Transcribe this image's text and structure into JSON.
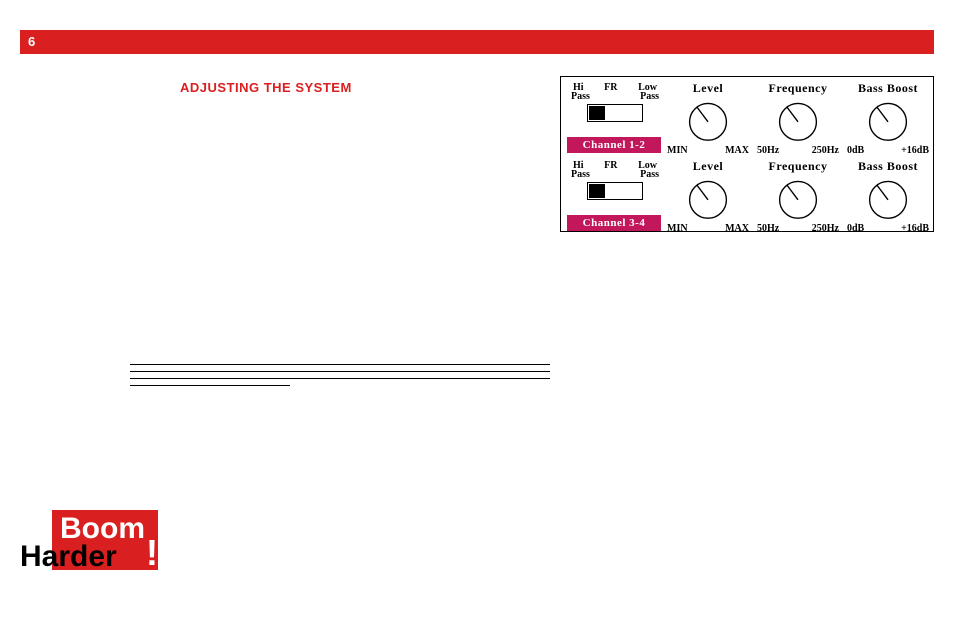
{
  "header": {
    "page_number": "6"
  },
  "section": {
    "title": "ADJUSTING THE SYSTEM"
  },
  "panel": {
    "rows": [
      {
        "switch": {
          "top": {
            "hi": "Hi",
            "fr": "FR",
            "low": "Low"
          },
          "bottom": {
            "l": "Pass",
            "r": "Pass"
          }
        },
        "channel_label": "Channel 1-2",
        "knobs": [
          {
            "title": "Level",
            "min": "MIN",
            "max": "MAX"
          },
          {
            "title": "Frequency",
            "min": "50Hz",
            "max": "250Hz"
          },
          {
            "title": "Bass Boost",
            "min": "0dB",
            "max": "+16dB"
          }
        ]
      },
      {
        "switch": {
          "top": {
            "hi": "Hi",
            "fr": "FR",
            "low": "Low"
          },
          "bottom": {
            "l": "Pass",
            "r": "Pass"
          }
        },
        "channel_label": "Channel 3-4",
        "knobs": [
          {
            "title": "Level",
            "min": "MIN",
            "max": "MAX"
          },
          {
            "title": "Frequency",
            "min": "50Hz",
            "max": "250Hz"
          },
          {
            "title": "Bass Boost",
            "min": "0dB",
            "max": "+16dB"
          }
        ]
      }
    ]
  },
  "logo": {
    "line1": "Boom",
    "line2": "Harder",
    "excl": "!"
  }
}
